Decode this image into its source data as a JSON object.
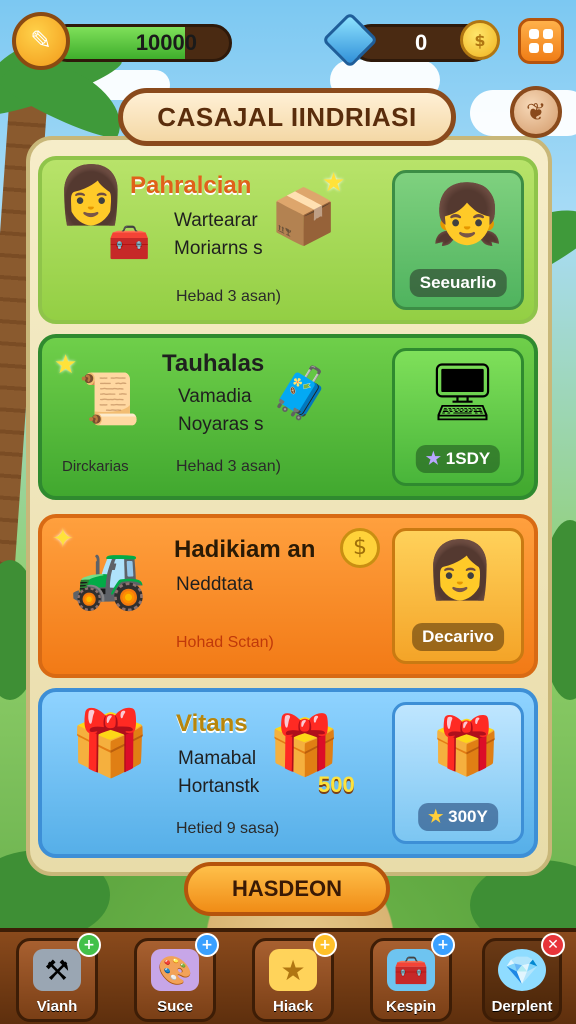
{
  "hud": {
    "coins_value": "10000",
    "coins_progress": 0.75,
    "gems_value": "0"
  },
  "title": "CASAJAL IINDRIASI",
  "cards": [
    {
      "title": "Pahralcian",
      "line1": "Wartearar",
      "line2": "Moriarns s",
      "sub": "Hebad 3 asan)",
      "side_label": "Seeuarlio"
    },
    {
      "title": "Tauhalas",
      "line1": "Vamadia",
      "line2": "Noyaras s",
      "sub": "Hehad 3 asan)",
      "left_label": "Dirckarias",
      "side_label": "1SDY"
    },
    {
      "title": "Hadikiam an",
      "line1": "Neddtata",
      "sub": "Hohad Sctan)",
      "side_label": "Decarivo"
    },
    {
      "title": "Vitans",
      "line1": "Mamabal",
      "line2": "Hortanstk",
      "gift_value": "500",
      "sub": "Hetied 9 sasa)",
      "side_label": "300Y"
    }
  ],
  "cta_label": "HASDEON",
  "nav": [
    {
      "label": "Vianh",
      "icon": "anvil-icon"
    },
    {
      "label": "Suce",
      "icon": "paint-icon"
    },
    {
      "label": "Hiack",
      "icon": "star-icon"
    },
    {
      "label": "Kespin",
      "icon": "toolbox-icon"
    },
    {
      "label": "Derplent",
      "icon": "crystal-icon"
    }
  ],
  "colors": {
    "accent_orange": "#f08c16",
    "brown": "#8a4a1c",
    "green": "#41a82f",
    "blue": "#56afe8"
  }
}
